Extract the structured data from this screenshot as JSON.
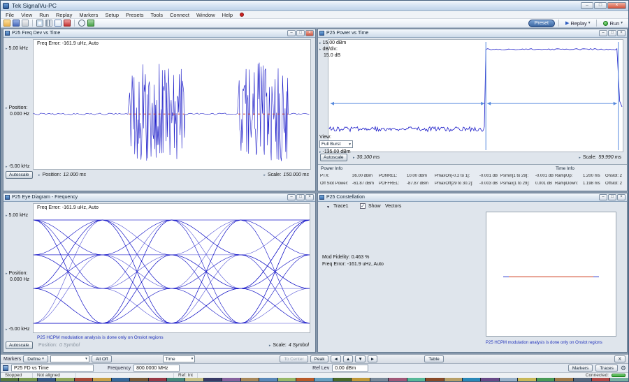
{
  "icons": {
    "axis_marker": "▸",
    "caret_down": "▾",
    "play": "▶",
    "close_x": "×",
    "check": "✓",
    "gear": "⚙",
    "arrow_left": "◄",
    "arrow_right": "►",
    "arrow_up": "▲",
    "arrow_down": "▼",
    "expander": "▼",
    "minimize": "–",
    "maximize": "□"
  },
  "colors": {
    "trace": "#1a1ac8",
    "marker_red": "#cc3322",
    "cursor_blue": "#5588dd",
    "note_blue": "#2233bb",
    "run_green": "#33aa33",
    "connected_green": "#44bb44"
  },
  "window": {
    "title": "Tek SignalVu-PC",
    "menus": [
      "File",
      "View",
      "Run",
      "Replay",
      "Markers",
      "Setup",
      "Presets",
      "Tools",
      "Connect",
      "Window",
      "Help"
    ]
  },
  "toolbar": {
    "preset": "Preset",
    "replay": "Replay",
    "run": "Run"
  },
  "freq_dev_panel": {
    "title": "P25 Freq Dev vs Time",
    "freq_error": "Freq Error: -161.9 uHz, Auto",
    "y_max": "5.00 kHz",
    "y_min": "-5.00 kHz",
    "position_label": "Position:",
    "position_value": "0.000 Hz",
    "autoscale": "Autoscale",
    "x_position_label": "Position:",
    "x_position_value": "12.000 ms",
    "x_scale_label": "Scale:",
    "x_scale_value": "150.000 ms"
  },
  "power_panel": {
    "title": "P25 Power vs Time",
    "y_max": "15.00 dBm",
    "db_div_label": "dB/div:",
    "db_div_value": "15.0 dB",
    "view_label": "View:",
    "view_value": "Full Burst",
    "y_min": "-135.00 dBm",
    "autoscale": "Autoscale",
    "x_position_value": "30.100 ms",
    "x_scale_label": "Scale:",
    "x_scale_value": "59.990 ms",
    "power_info_header": "Power Info",
    "time_info_header": "Time Info",
    "rows": [
      {
        "l1": "PTX:",
        "v1": "36.00 dBm",
        "l2": "PONREL:",
        "v2": "10.00 dBm",
        "l3": "PmaxOn[-0.2 to 1]:",
        "v3": "-0.001 dB",
        "l4": "Psmin[1 to 29]:",
        "v4": "-0.001 dB",
        "l5": "RampUp:",
        "v5": "1.200 ms",
        "l6": "Onslot: 2"
      },
      {
        "l1": "Off Slot Power:",
        "v1": "-61.87 dBm",
        "l2": "POFFREL:",
        "v2": "-87.87 dBm",
        "l3": "PmaxOff[29 to 30.2]:",
        "v3": "-0.003 dB",
        "l4": "Psmax[1 to 29]:",
        "v4": "0.001 dB",
        "l5": "RampDown:",
        "v5": "1.198 ms",
        "l6": "Offslot: 2"
      }
    ]
  },
  "eye_panel": {
    "title": "P25 Eye Diagram - Frequency",
    "freq_error": "Freq Error: -161.9 uHz, Auto",
    "y_max": "5.00 kHz",
    "y_min": "-5.00 kHz",
    "position_label": "Position:",
    "position_value": "0.000 Hz",
    "autoscale": "Autoscale",
    "note": "P25 HCPM modulation analysis is done only on Onslot regions",
    "x_position_label": "Position:",
    "x_position_value": "0 Symbol",
    "x_scale_label": "Scale:",
    "x_scale_value": "4 Symbol"
  },
  "constellation_panel": {
    "title": "P25 Constellation",
    "trace_label": "Trace1",
    "show_label": "Show",
    "vectors_label": "Vectors",
    "mod_fidelity_label": "Mod Fidelity:",
    "mod_fidelity_value": "0.463 %",
    "freq_error": "Freq Error: -161.9 uHz, Auto",
    "note": "P25 HCPM modulation analysis is done only on Onslot regions"
  },
  "markers_bar": {
    "label": "Markers",
    "define": "Define",
    "all_off": "All Off",
    "time": "Time",
    "to_center": "To Center",
    "peak": "Peak",
    "table": "Table",
    "close": "X"
  },
  "settings_bar": {
    "measurement": "P25 FD vs Time",
    "frequency_label": "Frequency",
    "frequency_value": "800.0000 MHz",
    "ref_lev_label": "Ref Lev",
    "ref_lev_value": "0.00 dBm",
    "markers": "Markers",
    "traces": "Traces"
  },
  "status_bar": {
    "acq": "Stopped",
    "align": "Not aligned",
    "ref": "Ref: Int",
    "connected": "Connected:"
  },
  "taskbar": {
    "colors": [
      "#5a7a40",
      "#7a9a50",
      "#3a5a86",
      "#90a85a",
      "#a84a38",
      "#c8a048",
      "#38689a",
      "#7a5a38",
      "#983a46",
      "#48887a",
      "#c8c288",
      "#383a66",
      "#86629e",
      "#a8885a",
      "#5a88b8",
      "#98b868",
      "#b85a28",
      "#68a0c0",
      "#4a6a2a",
      "#c09838",
      "#7a8a9a",
      "#a05878",
      "#58b898",
      "#884a28",
      "#b8a068",
      "#2a88b8",
      "#684a88",
      "#98b0c8",
      "#c8b858",
      "#4a9a56",
      "#a07a48",
      "#58687e",
      "#b04a48",
      "#78b0a0"
    ]
  }
}
